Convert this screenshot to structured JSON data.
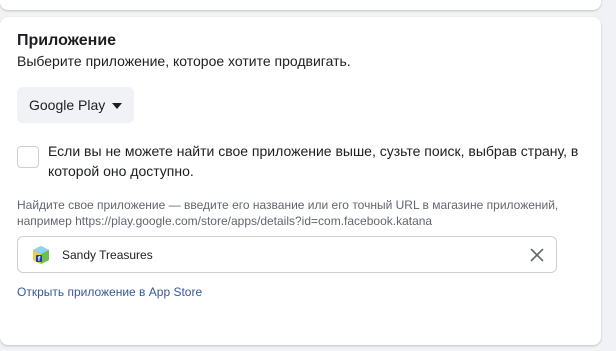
{
  "section": {
    "title": "Приложение",
    "subtitle": "Выберите приложение, которое хотите продвигать."
  },
  "store_select": {
    "selected": "Google Play"
  },
  "search_option": {
    "label": "Если вы не можете найти свое приложение выше, сузьте поиск, выбрав страну, в которой оно доступно."
  },
  "help": {
    "text": "Найдите свое приложение — введите его название или его точный URL в магазине приложений, например https://play.google.com/store/apps/details?id=com.facebook.katana"
  },
  "selected_app": {
    "name": "Sandy Treasures",
    "icon": "sandy-treasures-app-icon"
  },
  "open_link": {
    "label": "Открыть приложение в App Store"
  },
  "colors": {
    "background": "#f0f2f5",
    "link": "#385898",
    "muted_text": "#606770",
    "border": "#ccd0d5"
  }
}
